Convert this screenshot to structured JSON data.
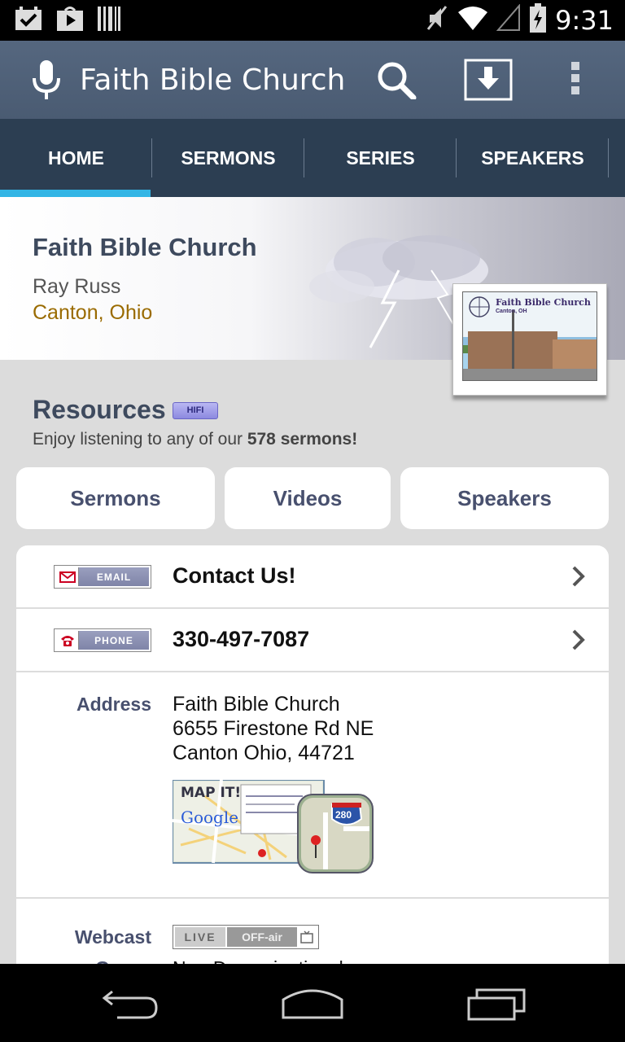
{
  "status_bar": {
    "time": "9:31",
    "left_icons": [
      "task-icon",
      "play-store-icon",
      "barcode-icon"
    ],
    "right_icons": [
      "mute-icon",
      "wifi-icon",
      "signal-icon",
      "battery-icon"
    ]
  },
  "action_bar": {
    "title": "Faith Bible Church",
    "icons": [
      "mic-icon",
      "search-icon",
      "download-icon",
      "overflow-menu-icon"
    ]
  },
  "tabs": [
    {
      "label": "HOME",
      "active": true
    },
    {
      "label": "SERMONS",
      "active": false
    },
    {
      "label": "SERIES",
      "active": false
    },
    {
      "label": "SPEAKERS",
      "active": false
    }
  ],
  "header": {
    "church_name": "Faith Bible Church",
    "speaker": "Ray Russ",
    "location": "Canton, Ohio",
    "photo_label": "Faith Bible Church",
    "photo_sublabel": "Canton, OH"
  },
  "resources": {
    "title": "Resources",
    "badge": "HIFI",
    "subtitle_prefix": "Enjoy listening to any of our ",
    "subtitle_bold": "578 sermons!",
    "buttons": [
      "Sermons",
      "Videos",
      "Speakers"
    ]
  },
  "contact": {
    "email_badge": "EMAIL",
    "email_text": "Contact Us!",
    "phone_badge": "PHONE",
    "phone_text": "330-497-7087"
  },
  "address": {
    "label": "Address",
    "line1": "Faith Bible Church",
    "line2": "6655 Firestone Rd NE",
    "line3": "Canton Ohio, 44721",
    "map_button": "MAP IT!",
    "map_brand": "Google",
    "map_route": "280"
  },
  "webcast": {
    "label": "Webcast",
    "live": "LIVE",
    "status": "OFF-air"
  },
  "group": {
    "label": "Group",
    "value": "Non-Denominational"
  },
  "nav_bar": {
    "icons": [
      "back-icon",
      "home-icon",
      "recents-icon"
    ]
  },
  "colors": {
    "action_bar": "#4f6178",
    "tab_bar": "#2c3e52",
    "tab_indicator": "#33b5e5",
    "heading": "#3e4a5e",
    "location": "#9a6b00",
    "button_text": "#48506e"
  }
}
